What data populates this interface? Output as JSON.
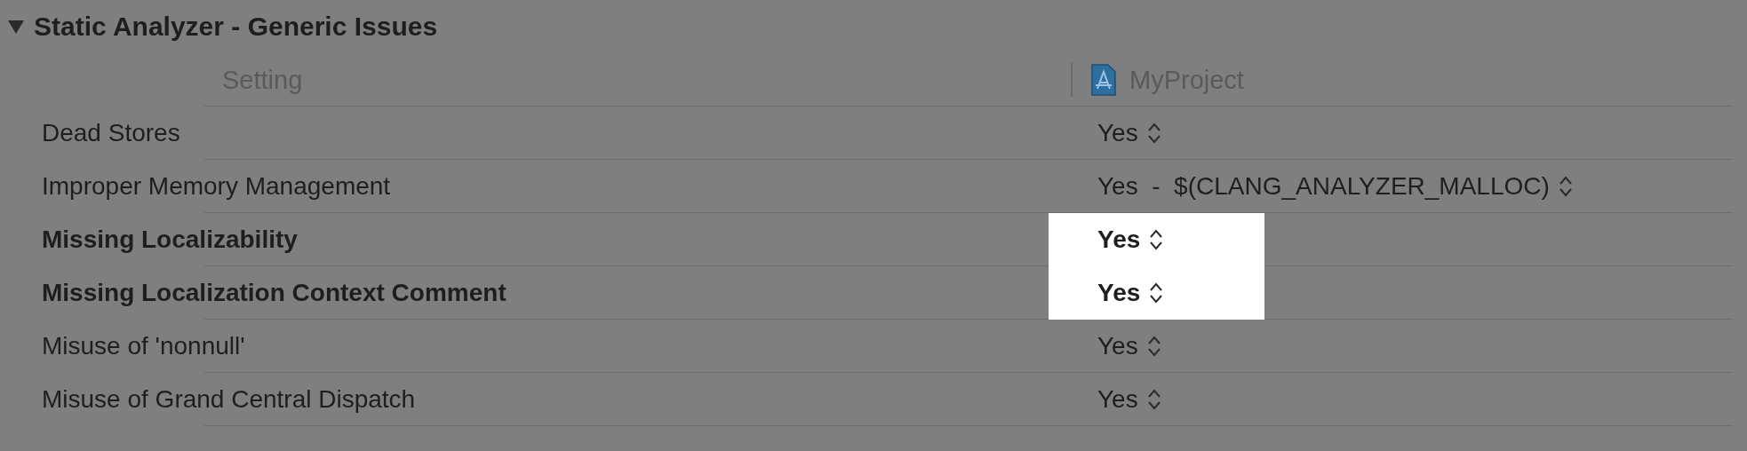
{
  "section": {
    "title": "Static Analyzer - Generic Issues",
    "expanded": true
  },
  "columns": {
    "setting": "Setting",
    "target": "MyProject"
  },
  "rows": [
    {
      "name": "Dead Stores",
      "value": "Yes",
      "modified": false,
      "highlighted": false
    },
    {
      "name": "Improper Memory Management",
      "value": "Yes  -  $(CLANG_ANALYZER_MALLOC)",
      "modified": false,
      "highlighted": false
    },
    {
      "name": "Missing Localizability",
      "value": "Yes",
      "modified": true,
      "highlighted": true
    },
    {
      "name": "Missing Localization Context Comment",
      "value": "Yes",
      "modified": true,
      "highlighted": true
    },
    {
      "name": "Misuse of 'nonnull'",
      "value": "Yes",
      "modified": false,
      "highlighted": false
    },
    {
      "name": "Misuse of Grand Central Dispatch",
      "value": "Yes",
      "modified": false,
      "highlighted": false
    }
  ]
}
